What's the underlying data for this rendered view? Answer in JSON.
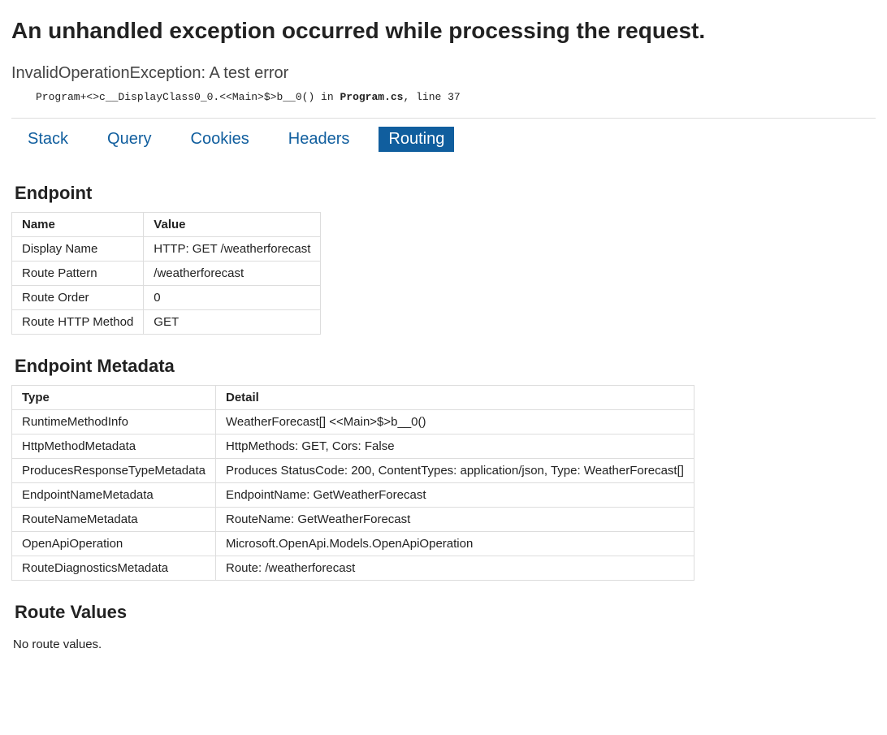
{
  "page_title": "An unhandled exception occurred while processing the request.",
  "exception_message": "InvalidOperationException: A test error",
  "stack_prefix": "Program+<>c__DisplayClass0_0.<<Main>$>b__0() in ",
  "stack_file": "Program.cs",
  "stack_suffix": ", line 37",
  "tabs": {
    "stack": "Stack",
    "query": "Query",
    "cookies": "Cookies",
    "headers": "Headers",
    "routing": "Routing"
  },
  "endpoint": {
    "heading": "Endpoint",
    "headers": {
      "name": "Name",
      "value": "Value"
    },
    "rows": [
      {
        "name": "Display Name",
        "value": "HTTP: GET /weatherforecast"
      },
      {
        "name": "Route Pattern",
        "value": "/weatherforecast"
      },
      {
        "name": "Route Order",
        "value": "0"
      },
      {
        "name": "Route HTTP Method",
        "value": "GET"
      }
    ]
  },
  "metadata": {
    "heading": "Endpoint Metadata",
    "headers": {
      "type": "Type",
      "detail": "Detail"
    },
    "rows": [
      {
        "type": "RuntimeMethodInfo",
        "detail": "WeatherForecast[] <<Main>$>b__0()"
      },
      {
        "type": "HttpMethodMetadata",
        "detail": "HttpMethods: GET, Cors: False"
      },
      {
        "type": "ProducesResponseTypeMetadata",
        "detail": "Produces StatusCode: 200, ContentTypes: application/json, Type: WeatherForecast[]"
      },
      {
        "type": "EndpointNameMetadata",
        "detail": "EndpointName: GetWeatherForecast"
      },
      {
        "type": "RouteNameMetadata",
        "detail": "RouteName: GetWeatherForecast"
      },
      {
        "type": "OpenApiOperation",
        "detail": "Microsoft.OpenApi.Models.OpenApiOperation"
      },
      {
        "type": "RouteDiagnosticsMetadata",
        "detail": "Route: /weatherforecast"
      }
    ]
  },
  "route_values": {
    "heading": "Route Values",
    "none": "No route values."
  }
}
